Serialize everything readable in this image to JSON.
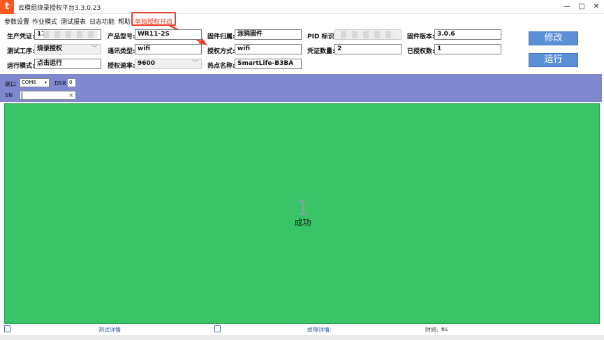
{
  "window": {
    "title": "云模组烧录授权平台3.3.0.23",
    "logo_glyph": "t",
    "minimize": "—",
    "maximize": "□",
    "close": "✕"
  },
  "menu": {
    "items": [
      "参数设置",
      "作业模式",
      "测试报表",
      "日志功能",
      "帮助"
    ],
    "highlighted": "单独授权开启",
    "highlight_color": "#e8412c"
  },
  "params": {
    "production_credential": {
      "label": "生产凭证:",
      "value": "17"
    },
    "product_model": {
      "label": "产品型号:",
      "value": "WR11-2S"
    },
    "firmware_owner": {
      "label": "固件归属:",
      "value": "涂鸦固件"
    },
    "pid": {
      "label": "PID 标识:",
      "value": ""
    },
    "firmware_version": {
      "label": "固件版本:",
      "value": "3.0.6"
    },
    "test_process": {
      "label": "测试工序:",
      "value": "烧录授权"
    },
    "comm_type": {
      "label": "通讯类型:",
      "value": "wifi"
    },
    "auth_method": {
      "label": "授权方式:",
      "value": "wifi"
    },
    "credential_count": {
      "label": "凭证数量:",
      "value": "2"
    },
    "authorized_count": {
      "label": "已授权数:",
      "value": "1"
    },
    "run_mode": {
      "label": "运行模式:",
      "value": "点击运行"
    },
    "auth_rate": {
      "label": "授权速率:",
      "value": "9600"
    },
    "hotspot_name": {
      "label": "热点名称:",
      "value": "SmartLife-B3BA"
    }
  },
  "buttons": {
    "modify": "修改",
    "run": "运行"
  },
  "port": {
    "port_label": "端口",
    "port_value": "COM6",
    "dsr_label": "DSR",
    "dsr_value": "0",
    "sn_label": "SN",
    "sn_value": "",
    "sn_clear": "×"
  },
  "result": {
    "count": "1",
    "status": "成功",
    "color": "#3ac468"
  },
  "status": {
    "test_details": "测试详情",
    "fault_details": "故障详情:",
    "time_label": "时间:",
    "time_value": "6s"
  }
}
